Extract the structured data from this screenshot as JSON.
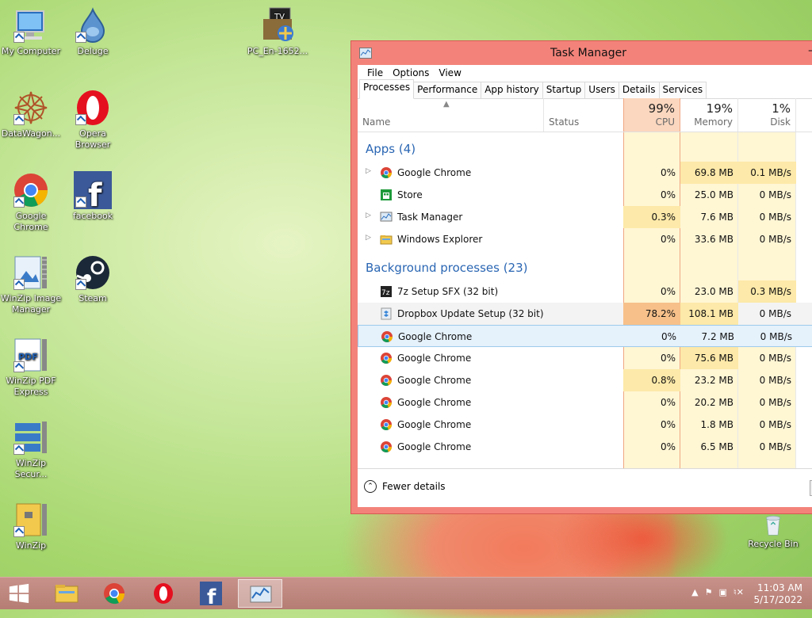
{
  "desktop": {
    "icons": [
      {
        "label": "My Computer"
      },
      {
        "label": "Deluge"
      },
      {
        "label": "PC_En-1652..."
      },
      {
        "label": "DataWagon..."
      },
      {
        "label": "Opera Browser"
      },
      {
        "label": "Google Chrome"
      },
      {
        "label": "facebook"
      },
      {
        "label": "WinZip Image Manager"
      },
      {
        "label": "Steam"
      },
      {
        "label": "WinZip PDF Express"
      },
      {
        "label": "WinZip Secur..."
      },
      {
        "label": "WinZip"
      },
      {
        "label": "Recycle Bin"
      }
    ]
  },
  "window": {
    "title": "Task Manager",
    "menu": [
      "File",
      "Options",
      "View"
    ],
    "tabs": [
      "Processes",
      "Performance",
      "App history",
      "Startup",
      "Users",
      "Details",
      "Services"
    ],
    "active_tab": "Processes",
    "columns": {
      "name": "Name",
      "status": "Status",
      "cpu": {
        "pct": "99%",
        "label": "CPU"
      },
      "memory": {
        "pct": "19%",
        "label": "Memory"
      },
      "disk": {
        "pct": "1%",
        "label": "Disk"
      }
    },
    "groups": {
      "apps": "Apps (4)",
      "background": "Background processes (23)"
    },
    "apps": [
      {
        "name": "Google Chrome",
        "cpu": "0%",
        "mem": "69.8 MB",
        "disk": "0.1 MB/s"
      },
      {
        "name": "Store",
        "cpu": "0%",
        "mem": "25.0 MB",
        "disk": "0 MB/s"
      },
      {
        "name": "Task Manager",
        "cpu": "0.3%",
        "mem": "7.6 MB",
        "disk": "0 MB/s"
      },
      {
        "name": "Windows Explorer",
        "cpu": "0%",
        "mem": "33.6 MB",
        "disk": "0 MB/s"
      }
    ],
    "background": [
      {
        "name": "7z Setup SFX (32 bit)",
        "cpu": "0%",
        "mem": "23.0 MB",
        "disk": "0.3 MB/s"
      },
      {
        "name": "Dropbox Update Setup (32 bit)",
        "cpu": "78.2%",
        "mem": "108.1 MB",
        "disk": "0 MB/s"
      },
      {
        "name": "Google Chrome",
        "cpu": "0%",
        "mem": "7.2 MB",
        "disk": "0 MB/s"
      },
      {
        "name": "Google Chrome",
        "cpu": "0%",
        "mem": "75.6 MB",
        "disk": "0 MB/s"
      },
      {
        "name": "Google Chrome",
        "cpu": "0.8%",
        "mem": "23.2 MB",
        "disk": "0 MB/s"
      },
      {
        "name": "Google Chrome",
        "cpu": "0%",
        "mem": "20.2 MB",
        "disk": "0 MB/s"
      },
      {
        "name": "Google Chrome",
        "cpu": "0%",
        "mem": "1.8 MB",
        "disk": "0 MB/s"
      },
      {
        "name": "Google Chrome",
        "cpu": "0%",
        "mem": "6.5 MB",
        "disk": "0 MB/s"
      }
    ],
    "fewer_details": "Fewer details"
  },
  "taskbar": {
    "time": "11:03 AM",
    "date": "5/17/2022"
  },
  "colors": {
    "titlebar": "#f3837a",
    "cpu_header": "#fbd7bf",
    "heat_light": "#fff4c4",
    "heat_mid": "#fde9a9",
    "heat_strong": "#f7c08a",
    "group_text": "#2a66b3"
  }
}
